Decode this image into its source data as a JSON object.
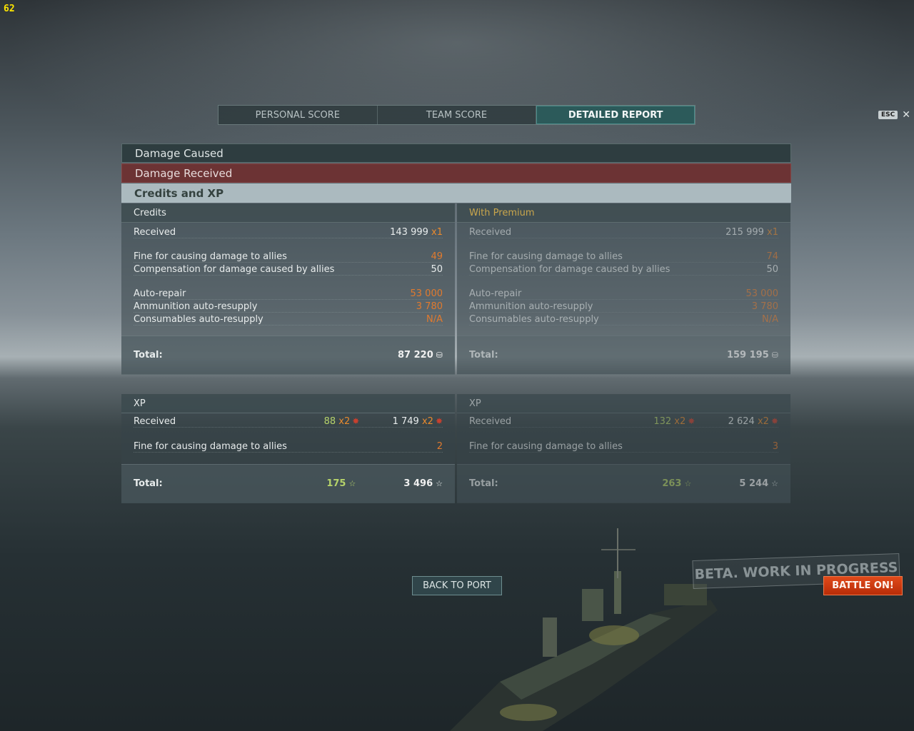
{
  "fps": "62",
  "tabs": [
    {
      "label": "PERSONAL SCORE"
    },
    {
      "label": "TEAM SCORE"
    },
    {
      "label": "DETAILED REPORT",
      "active": true
    }
  ],
  "esc": {
    "key": "ESC",
    "close": "✕"
  },
  "sections": {
    "damage_caused": "Damage Caused",
    "damage_received": "Damage Received",
    "credits_xp": "Credits and XP"
  },
  "credits": {
    "title": "Credits",
    "received_label": "Received",
    "received_value": "143 999",
    "received_mult": "x1",
    "fine_label": "Fine for causing damage to allies",
    "fine_value": "49",
    "comp_label": "Compensation for damage caused by allies",
    "comp_value": "50",
    "autorepair_label": "Auto-repair",
    "autorepair_value": "53 000",
    "ammo_label": "Ammunition auto-resupply",
    "ammo_value": "3 780",
    "consumables_label": "Consumables auto-resupply",
    "consumables_value": "N/A",
    "total_label": "Total:",
    "total_value": "87 220"
  },
  "premium": {
    "title": "With Premium",
    "received_label": "Received",
    "received_value": "215 999",
    "received_mult": "x1",
    "fine_label": "Fine for causing damage to allies",
    "fine_value": "74",
    "comp_label": "Compensation for damage caused by allies",
    "comp_value": "50",
    "autorepair_label": "Auto-repair",
    "autorepair_value": "53 000",
    "ammo_label": "Ammunition auto-resupply",
    "ammo_value": "3 780",
    "consumables_label": "Consumables auto-resupply",
    "consumables_value": "N/A",
    "total_label": "Total:",
    "total_value": "159 195"
  },
  "xp": {
    "title": "XP",
    "received_label": "Received",
    "received_xp": "88",
    "received_xp_mult": "x2",
    "received_fxp": "1 749",
    "received_fxp_mult": "x2",
    "fine_label": "Fine for causing damage to allies",
    "fine_value": "2",
    "total_label": "Total:",
    "total_xp": "175",
    "total_fxp": "3 496"
  },
  "xp_premium": {
    "title": "XP",
    "received_label": "Received",
    "received_xp": "132",
    "received_xp_mult": "x2",
    "received_fxp": "2 624",
    "received_fxp_mult": "x2",
    "fine_label": "Fine for causing damage to allies",
    "fine_value": "3",
    "total_label": "Total:",
    "total_xp": "263",
    "total_fxp": "5 244"
  },
  "buttons": {
    "back_to_port": "BACK TO PORT",
    "battle_on": "BATTLE ON!"
  },
  "watermark": "BETA. WORK IN PROGRESS",
  "icons": {
    "credits": "coin-icon",
    "xp": "star-icon",
    "flag": "flag-badge-icon"
  },
  "colors": {
    "active_tab": "#2c5a5a",
    "fine": "#e07a2e",
    "xp": "#b6d36a",
    "premium_title": "#c9a64c",
    "battle": "#d03c12"
  }
}
